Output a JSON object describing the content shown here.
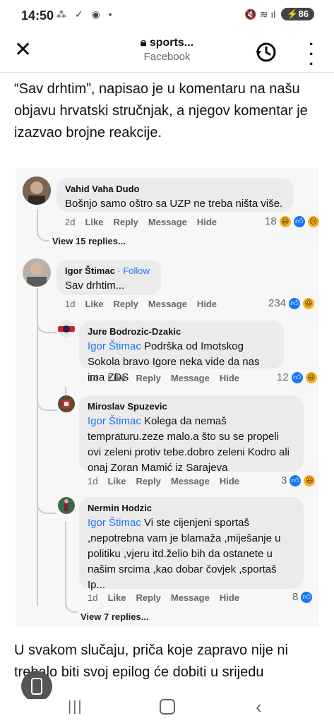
{
  "status_bar": {
    "time": "14:50",
    "left_icons": "⁂ ✓ ◉ •",
    "battery": "86",
    "right_icons": "🔇 ≋ ıl"
  },
  "browser": {
    "title": "sports...",
    "subtitle": "Facebook"
  },
  "article": {
    "para1": "“Sav drhtim”, napisao je u komentaru na našu objavu hrvatski stručnjak, a njegov komentar je izazvao brojne reakcije.",
    "para2": "U svakom slučaju, priča koje zapravo nije ni trebalo biti svoj epilog će dobiti u srijedu"
  },
  "comments": [
    {
      "name": "Vahid Vaha Dudo",
      "text": "Bošnjo samo oštro sa UZP ne treba ništa više.",
      "age": "2d",
      "like": "Like",
      "reply": "Reply",
      "message": "Message",
      "hide": "Hide",
      "count": "18",
      "view_replies": "View 15 replies..."
    },
    {
      "name": "Igor Štimac",
      "follow": "· Follow",
      "text": "Sav drhtim...",
      "age": "1d",
      "like": "Like",
      "reply": "Reply",
      "message": "Message",
      "hide": "Hide",
      "count": "234"
    }
  ],
  "replies": [
    {
      "name": "Jure Bodrozic-Dzakic",
      "mention": "Igor Štimac",
      "text": " Podrška od Imotskog Sokola bravo Igore neka vide da nas ima ZDS",
      "age": "1d",
      "like": "Like",
      "reply": "Reply",
      "message": "Message",
      "hide": "Hide",
      "count": "12"
    },
    {
      "name": "Miroslav Spuzevic",
      "mention": "Igor Štimac",
      "text": " Kolega da nemaš tempraturu.zeze malo.a što su se propeli ovi zeleni protiv tebe.dobro zeleni Kodro ali onaj Zoran Mamić iz Sarajeva",
      "age": "1d",
      "like": "Like",
      "reply": "Reply",
      "message": "Message",
      "hide": "Hide",
      "count": "3"
    },
    {
      "name": "Nermin Hodzic",
      "mention": "Igor Štimac",
      "text": " Vi ste cijenjeni sportaš ,nepotrebna vam je blamaža ,miješanje u politiku ,vjeru itd.želio bih da ostanete u našim srcima ,kao dobar čovjek ,sportaš  Ip...",
      "age": "1d",
      "like": "Like",
      "reply": "Reply",
      "message": "Message",
      "hide": "Hide",
      "count": "8",
      "view_replies": "View 7 replies..."
    }
  ],
  "colors": {
    "link": "#1877f2",
    "bubble": "#ebebeb",
    "panel": "#f7f7f7"
  }
}
